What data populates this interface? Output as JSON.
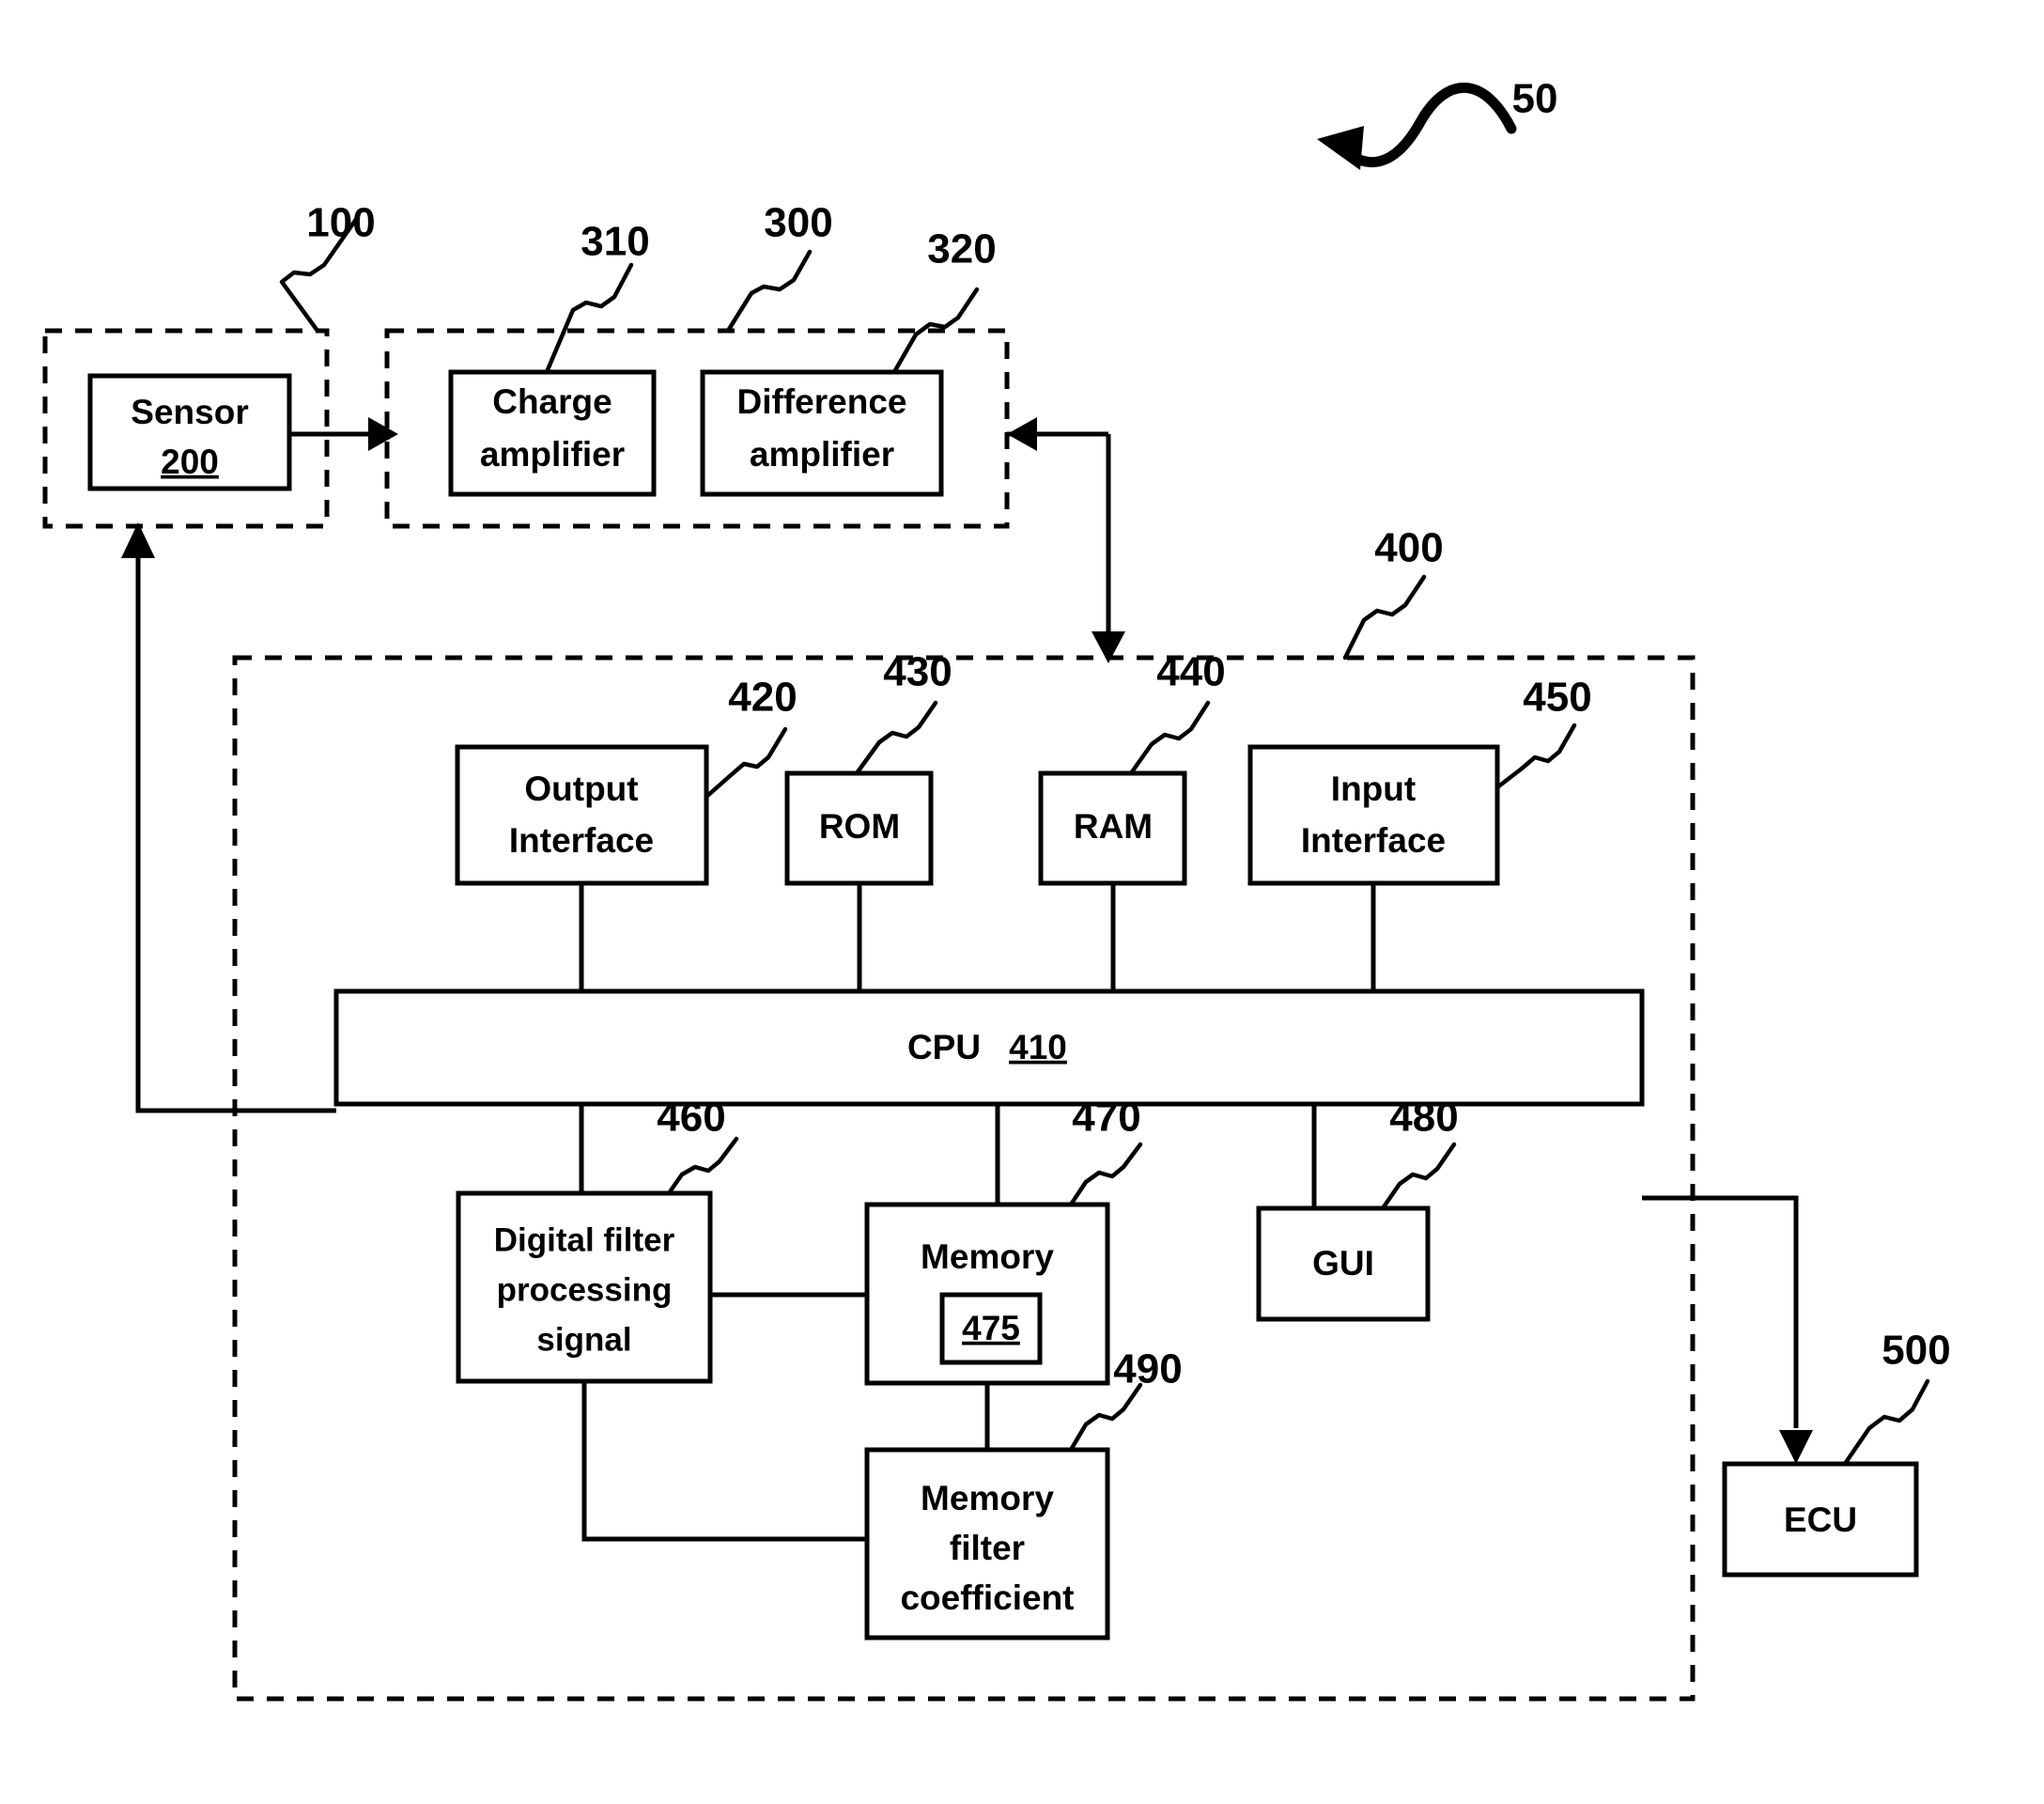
{
  "figure": {
    "type": "patent-block-diagram",
    "overall_ref": "50",
    "background_color": "#ffffff",
    "line_color": "#000000"
  },
  "groups": {
    "sensor_unit": {
      "ref": "100",
      "style": "dashed"
    },
    "amplifier_unit": {
      "ref": "300",
      "style": "dashed"
    },
    "processor_unit": {
      "ref": "400",
      "style": "dashed"
    }
  },
  "blocks": {
    "sensor": {
      "label_line1": "Sensor",
      "ref_inside": "200"
    },
    "charge_amplifier": {
      "label_line1": "Charge",
      "label_line2": "amplifier",
      "ref": "310"
    },
    "difference_amplifier": {
      "label_line1": "Difference",
      "label_line2": "amplifier",
      "ref": "320"
    },
    "output_interface": {
      "label_line1": "Output",
      "label_line2": "Interface",
      "ref": "420"
    },
    "rom": {
      "label_line1": "ROM",
      "ref": "430"
    },
    "ram": {
      "label_line1": "RAM",
      "ref": "440"
    },
    "input_interface": {
      "label_line1": "Input",
      "label_line2": "Interface",
      "ref": "450"
    },
    "cpu": {
      "label_line1": "CPU",
      "ref_inside": "410"
    },
    "digital_filter": {
      "label_line1": "Digital filter",
      "label_line2": "processing",
      "label_line3": "signal",
      "ref": "460"
    },
    "memory": {
      "label_line1": "Memory",
      "ref": "470",
      "inner_ref": "475"
    },
    "gui": {
      "label_line1": "GUI",
      "ref": "480"
    },
    "memory_filter_coefficient": {
      "label_line1": "Memory",
      "label_line2": "filter",
      "label_line3": "coefficient",
      "ref": "490"
    },
    "ecu": {
      "label_line1": "ECU",
      "ref": "500"
    }
  }
}
